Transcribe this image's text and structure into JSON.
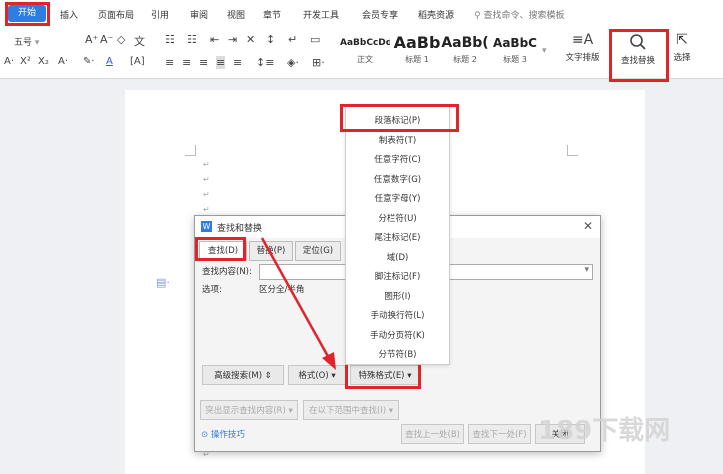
{
  "menubar": {
    "items": [
      "开始",
      "插入",
      "页面布局",
      "引用",
      "审阅",
      "视图",
      "章节",
      "开发工具",
      "会员专享",
      "稻壳资源"
    ],
    "search_label": "查找命令、搜索模板"
  },
  "ribbon": {
    "font_size": "五号",
    "styles": [
      {
        "sample": "AaBbCcDd",
        "name": "正文"
      },
      {
        "sample": "AaBb",
        "name": "标题 1"
      },
      {
        "sample": "AaBb(",
        "name": "标题 2"
      },
      {
        "sample": "AaBbC",
        "name": "标题 3"
      }
    ],
    "text_layout_label": "文字排版",
    "find_replace_label": "查找替换",
    "select_label": "选择"
  },
  "special_menu": {
    "items": [
      "段落标记(P)",
      "制表符(T)",
      "任意字符(C)",
      "任意数字(G)",
      "任意字母(Y)",
      "分栏符(U)",
      "尾注标记(E)",
      "域(D)",
      "脚注标记(F)",
      "图形(I)",
      "手动换行符(L)",
      "手动分页符(K)",
      "分节符(B)"
    ]
  },
  "dialog": {
    "title": "查找和替换",
    "tabs": [
      "查找(D)",
      "替换(P)",
      "定位(G)"
    ],
    "find_label": "查找内容(N):",
    "options_label": "选项:",
    "options_value": "区分全/半角",
    "advanced_btn": "高级搜索(M)",
    "format_btn": "格式(O)",
    "special_btn": "特殊格式(E)",
    "highlight_btn": "突出显示查找内容(R)",
    "find_in_btn": "在以下范围中查找(I)",
    "tips_label": "操作技巧",
    "find_prev_btn": "查找上一处(B)",
    "find_next_btn": "查找下一处(F)",
    "close_btn": "关闭"
  },
  "watermark": {
    "text": "189下载网"
  },
  "colors": {
    "accent": "#2f7de1",
    "highlight": "#e0242c"
  }
}
